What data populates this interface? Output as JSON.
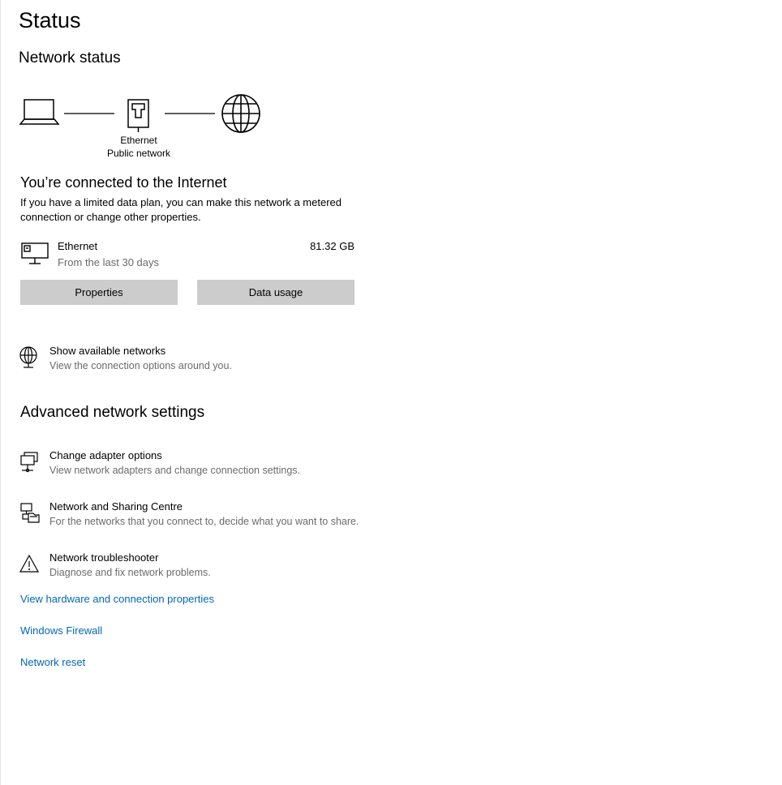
{
  "header": {
    "title": "Status"
  },
  "network_status": {
    "heading": "Network status",
    "adapter_name": "Ethernet",
    "network_type": "Public network"
  },
  "connection": {
    "heading": "You’re connected to the Internet",
    "description": "If you have a limited data plan, you can make this network a metered connection or change other properties."
  },
  "ethernet": {
    "name": "Ethernet",
    "period": "From the last 30 days",
    "usage": "81.32 GB"
  },
  "buttons": {
    "properties": "Properties",
    "data_usage": "Data usage"
  },
  "show_networks": {
    "icon": "globe-network-icon",
    "title": "Show available networks",
    "description": "View the connection options around you."
  },
  "advanced": {
    "heading": "Advanced network settings",
    "items": [
      {
        "icon": "adapter-options-icon",
        "title": "Change adapter options",
        "description": "View network adapters and change connection settings."
      },
      {
        "icon": "sharing-centre-icon",
        "title": "Network and Sharing Centre",
        "description": "For the networks that you connect to, decide what you want to share."
      },
      {
        "icon": "warning-triangle-icon",
        "title": "Network troubleshooter",
        "description": "Diagnose and fix network problems."
      }
    ]
  },
  "links": {
    "hardware": "View hardware and connection properties",
    "firewall": "Windows Firewall",
    "reset": "Network reset"
  },
  "colors": {
    "link": "#0067b8",
    "button_bg": "#cccccc",
    "secondary_text": "#6b6b6b"
  }
}
